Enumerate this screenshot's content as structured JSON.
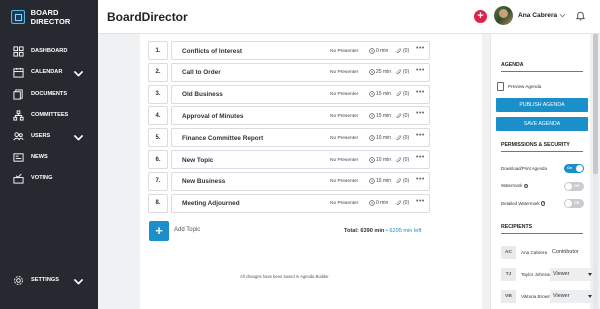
{
  "brand": {
    "name": "BOARD DIRECTOR"
  },
  "nav": [
    {
      "label": "DASHBOARD",
      "icon": "grid-icon"
    },
    {
      "label": "CALENDAR",
      "icon": "calendar-icon",
      "expandable": true
    },
    {
      "label": "DOCUMENTS",
      "icon": "documents-icon"
    },
    {
      "label": "COMMITTEES",
      "icon": "committees-icon"
    },
    {
      "label": "USERS",
      "icon": "users-icon",
      "expandable": true
    },
    {
      "label": "NEWS",
      "icon": "news-icon"
    },
    {
      "label": "VOTING",
      "icon": "voting-icon"
    }
  ],
  "settings": {
    "label": "SETTINGS",
    "icon": "gear-icon"
  },
  "header": {
    "title": "BoardDirector",
    "user_name": "Ana Cabrera",
    "add_symbol": "+"
  },
  "agenda_items": [
    {
      "num": "1.",
      "title": "Conflicts of Interest",
      "presenter": "No Presenter",
      "time": "0 min",
      "attachments": "(0)"
    },
    {
      "num": "2.",
      "title": "Call to Order",
      "presenter": "No Presenter",
      "time": "25 min",
      "attachments": "(0)"
    },
    {
      "num": "3.",
      "title": "Old Business",
      "presenter": "No Presenter",
      "time": "15 min",
      "attachments": "(0)"
    },
    {
      "num": "4.",
      "title": "Approval of Minutes",
      "presenter": "No Presenter",
      "time": "15 min",
      "attachments": "(0)"
    },
    {
      "num": "5.",
      "title": "Finance Committee Report",
      "presenter": "No Presenter",
      "time": "10 min",
      "attachments": "(0)"
    },
    {
      "num": "6.",
      "title": "New Topic",
      "presenter": "No Presenter",
      "time": "10 min",
      "attachments": "(0)"
    },
    {
      "num": "7.",
      "title": "New Business",
      "presenter": "No Presenter",
      "time": "15 min",
      "attachments": "(0)"
    },
    {
      "num": "8.",
      "title": "Meeting Adjourned",
      "presenter": "No Presenter",
      "time": "0 min",
      "attachments": "(0)"
    }
  ],
  "footer": {
    "add_symbol": "+",
    "add_topic": "Add Topic",
    "total": "Total: 6390 min",
    "separator": "•",
    "left": "6295 min left",
    "saved_message": "All changes have been saved in Agenda Builder"
  },
  "panel": {
    "agenda_heading": "AGENDA",
    "preview_label": "Preview Agenda",
    "publish_label": "PUBLISH AGENDA",
    "save_label": "SAVE AGENDA",
    "permissions_heading": "PERMISSIONS & SECURITY",
    "permissions": [
      {
        "label": "Download/Print Agenda",
        "state": "On",
        "on": true
      },
      {
        "label": "Watermark",
        "state": "Off",
        "on": false
      },
      {
        "label": "Detailed Watermark",
        "state": "Off",
        "on": false
      }
    ],
    "recipients_heading": "RECIPIENTS",
    "recipients": [
      {
        "initials": "AC",
        "name": "Ana Cabrera",
        "role": "Contributor",
        "editable": false
      },
      {
        "initials": "TJ",
        "name": "Taylor Johnson",
        "role": "Viewer",
        "editable": true
      },
      {
        "initials": "VB",
        "name": "Viktoria Brown",
        "role": "Viewer",
        "editable": true
      }
    ]
  },
  "colors": {
    "accent": "#1a8fc9",
    "sidebar": "#262a30",
    "add_button": "#e0214b"
  }
}
